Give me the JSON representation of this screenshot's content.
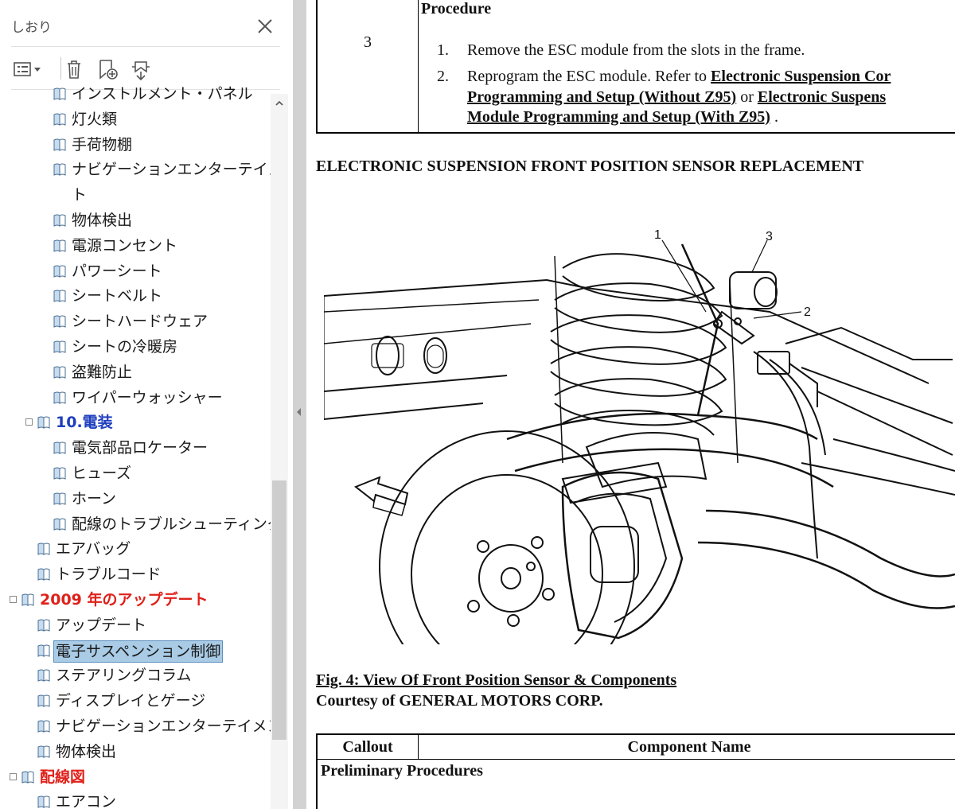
{
  "sidebar": {
    "title": "しおり",
    "toolbar": {
      "options_icon": "list-options-icon",
      "delete_icon": "trash-icon",
      "add_bookmark_icon": "new-bookmark-icon",
      "expand_icon": "expand-bookmark-icon"
    },
    "items": [
      {
        "label": "インストルメント・パネル",
        "level": 2,
        "toggle": "none"
      },
      {
        "label": "灯火類",
        "level": 2,
        "toggle": "none"
      },
      {
        "label": "手荷物棚",
        "level": 2,
        "toggle": "none"
      },
      {
        "label": "ナビゲーションエンターテイメン",
        "level": 2,
        "toggle": "none"
      },
      {
        "label": "ト",
        "level": 2,
        "toggle": "continuation"
      },
      {
        "label": "物体検出",
        "level": 2,
        "toggle": "none"
      },
      {
        "label": "電源コンセント",
        "level": 2,
        "toggle": "none"
      },
      {
        "label": "パワーシート",
        "level": 2,
        "toggle": "none"
      },
      {
        "label": "シートベルト",
        "level": 2,
        "toggle": "none"
      },
      {
        "label": "シートハードウェア",
        "level": 2,
        "toggle": "none"
      },
      {
        "label": "シートの冷暖房",
        "level": 2,
        "toggle": "none"
      },
      {
        "label": "盗難防止",
        "level": 2,
        "toggle": "none"
      },
      {
        "label": "ワイパーウォッシャー",
        "level": 2,
        "toggle": "none"
      },
      {
        "label": "10.電装",
        "level": 1,
        "toggle": "collapse",
        "color": "#1f3fbf",
        "bold": true
      },
      {
        "label": "電気部品ロケーター",
        "level": 2,
        "toggle": "none"
      },
      {
        "label": "ヒューズ",
        "level": 2,
        "toggle": "none"
      },
      {
        "label": "ホーン",
        "level": 2,
        "toggle": "none"
      },
      {
        "label": "配線のトラブルシューティング",
        "level": 2,
        "toggle": "none"
      },
      {
        "label": "エアバッグ",
        "level": 1,
        "toggle": "none"
      },
      {
        "label": "トラブルコード",
        "level": 1,
        "toggle": "none"
      },
      {
        "label": "2009 年のアップデート",
        "level": 0,
        "toggle": "collapse",
        "color": "#e0201a",
        "bold": true
      },
      {
        "label": "アップデート",
        "level": 1,
        "toggle": "none"
      },
      {
        "label": "電子サスペンション制御",
        "level": 1,
        "toggle": "none",
        "selected": true
      },
      {
        "label": "ステアリングコラム",
        "level": 1,
        "toggle": "none"
      },
      {
        "label": "ディスプレイとゲージ",
        "level": 1,
        "toggle": "none"
      },
      {
        "label": "ナビゲーションエンターテイメント",
        "level": 1,
        "toggle": "none"
      },
      {
        "label": "物体検出",
        "level": 1,
        "toggle": "none"
      },
      {
        "label": "配線図",
        "level": 0,
        "toggle": "collapse",
        "color": "#e0201a",
        "bold": true
      },
      {
        "label": "エアコン",
        "level": 1,
        "toggle": "none"
      }
    ]
  },
  "document": {
    "top_table": {
      "step_number": "3",
      "procedure_heading": "Procedure",
      "items": [
        {
          "num": "1.",
          "text": "Remove the ESC module from the slots in the frame."
        },
        {
          "num": "2.",
          "prefix": "Reprogram the ESC module. Refer to ",
          "link": "Electronic Suspension Cor"
        },
        {
          "num": "",
          "link": "Programming and Setup (Without Z95)",
          "middle": " or ",
          "link2": "Electronic Suspens"
        },
        {
          "num": "",
          "link": "Module Programming and Setup (With Z95)",
          "suffix": " ."
        }
      ]
    },
    "section_heading": "ELECTRONIC SUSPENSION FRONT POSITION SENSOR REPLACEMENT",
    "figure": {
      "callouts": [
        "1",
        "2",
        "3"
      ]
    },
    "fig_caption": "Fig. 4: View Of Front Position Sensor & Components",
    "fig_credit": "Courtesy of GENERAL MOTORS CORP.",
    "bottom_table": {
      "callout_header": "Callout",
      "component_header": "Component Name",
      "prelim_heading": "Preliminary Procedures"
    }
  }
}
